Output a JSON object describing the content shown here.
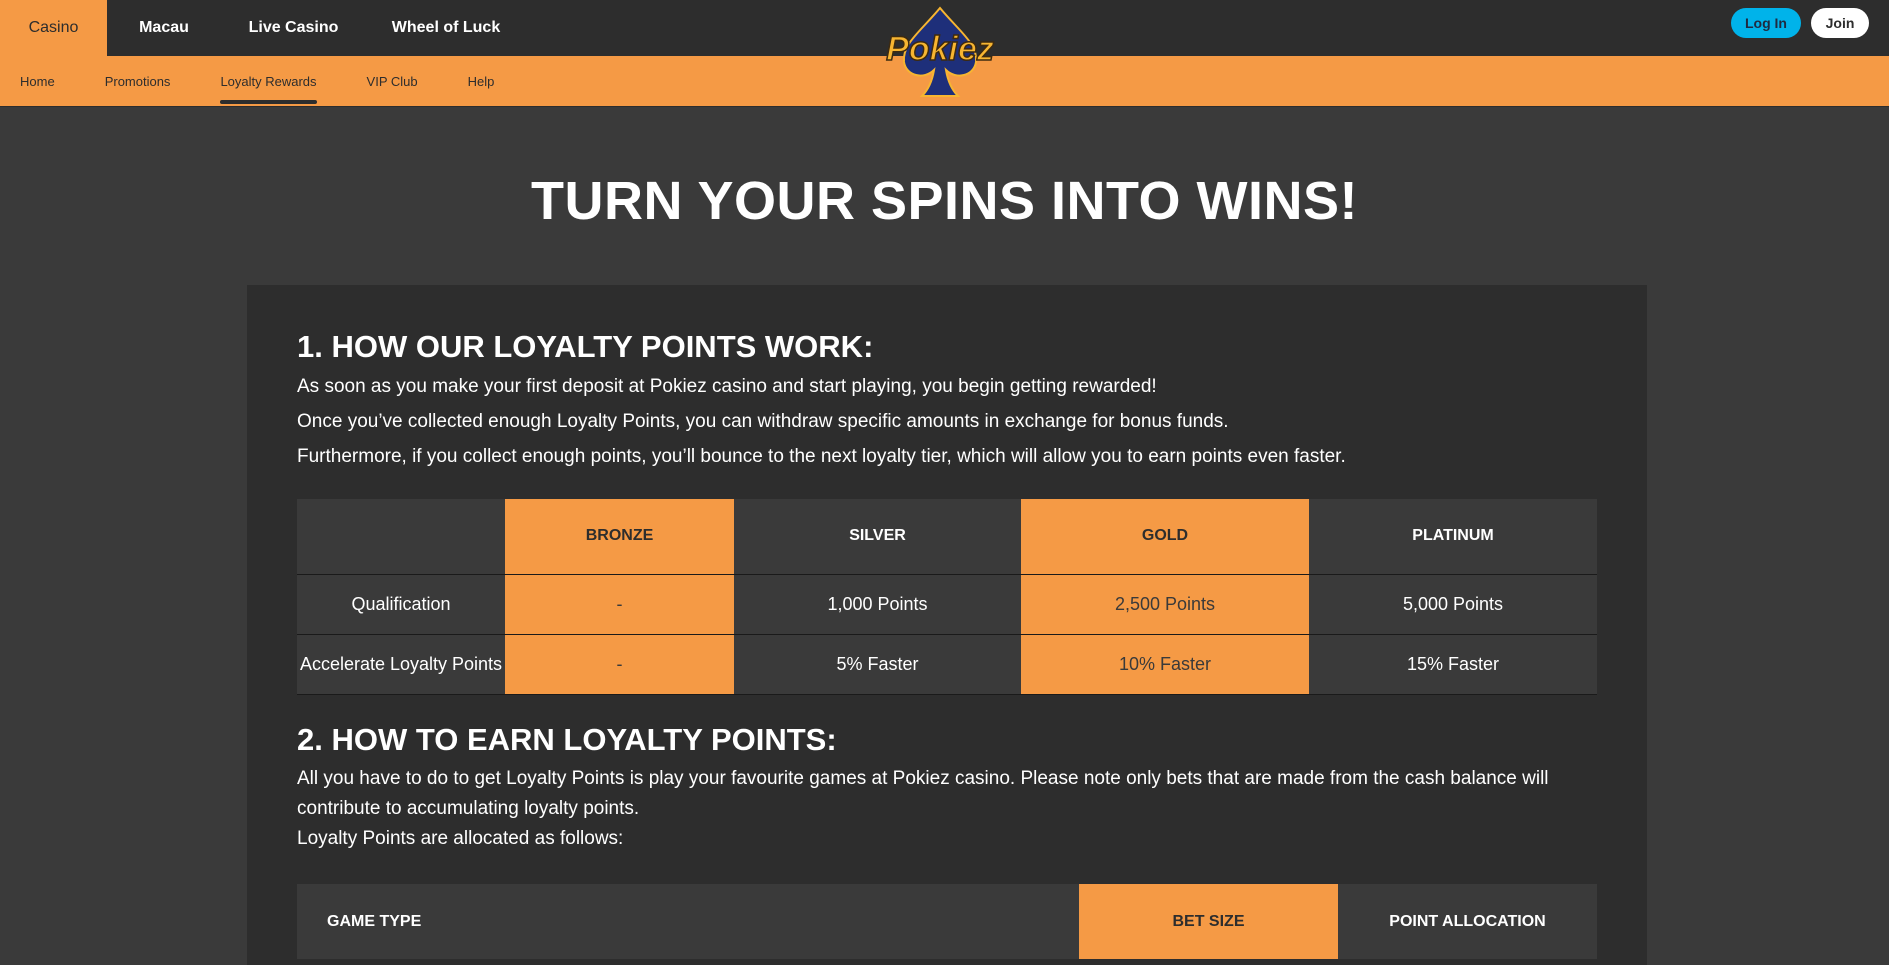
{
  "top_nav": {
    "tabs": [
      {
        "label": "Casino",
        "active": true
      },
      {
        "label": "Macau",
        "active": false
      },
      {
        "label": "Live Casino",
        "active": false
      },
      {
        "label": "Wheel of Luck",
        "active": false
      }
    ],
    "login_label": "Log In",
    "join_label": "Join"
  },
  "sub_nav": {
    "items": [
      {
        "label": "Home",
        "active": false
      },
      {
        "label": "Promotions",
        "active": false
      },
      {
        "label": "Loyalty Rewards",
        "active": true
      },
      {
        "label": "VIP Club",
        "active": false
      },
      {
        "label": "Help",
        "active": false
      }
    ]
  },
  "logo": {
    "text": "Pokiez"
  },
  "hero": {
    "title": "TURN YOUR SPINS INTO WINS!"
  },
  "section1": {
    "heading": "1. HOW OUR LOYALTY POINTS WORK:",
    "paragraphs": [
      "As soon as you make your first deposit at Pokiez casino and start playing, you begin getting rewarded!",
      "Once you’ve collected enough Loyalty Points, you can withdraw specific amounts in exchange for bonus funds.",
      "Furthermore, if you collect enough points, you’ll bounce to the next loyalty tier, which will allow you to earn points even faster."
    ],
    "table": {
      "headers": [
        "",
        "BRONZE",
        "SILVER",
        "GOLD",
        "PLATINUM"
      ],
      "rows": [
        [
          "Qualification",
          "-",
          "1,000 Points",
          "2,500 Points",
          "5,000 Points"
        ],
        [
          "Accelerate Loyalty Points",
          "-",
          "5% Faster",
          "10% Faster",
          "15% Faster"
        ]
      ]
    }
  },
  "section2": {
    "heading": "2. HOW TO EARN LOYALTY POINTS:",
    "paragraphs": [
      "All you have to do to get Loyalty Points is play your favourite games at Pokiez casino. Please note only bets that are made from the cash balance will contribute to accumulating loyalty points.",
      "Loyalty Points are allocated as follows:"
    ],
    "table": {
      "headers": [
        "GAME TYPE",
        "BET SIZE",
        "POINT ALLOCATION"
      ]
    }
  },
  "colors": {
    "accent": "#f59a45",
    "login": "#00b3ea",
    "nav_bg": "#2d2d2d",
    "page_bg": "#3a3a3a"
  }
}
